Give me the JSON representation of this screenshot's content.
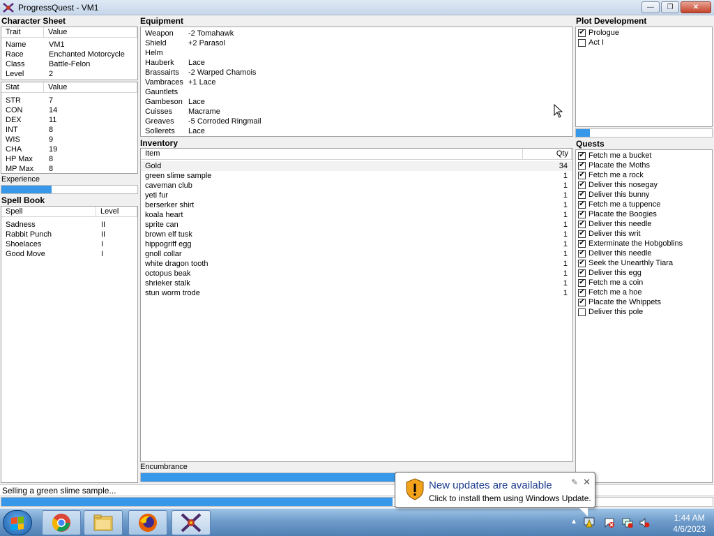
{
  "window": {
    "title": "ProgressQuest - VM1",
    "min": "—",
    "max": "❐",
    "close": "✕"
  },
  "character": {
    "section_title": "Character Sheet",
    "trait_header": "Trait",
    "value_header": "Value",
    "traits": [
      {
        "name": "Name",
        "value": "VM1"
      },
      {
        "name": "Race",
        "value": "Enchanted Motorcycle"
      },
      {
        "name": "Class",
        "value": "Battle-Felon"
      },
      {
        "name": "Level",
        "value": "2"
      }
    ],
    "stat_header": "Stat",
    "stat_value_header": "Value",
    "stats": [
      {
        "name": "STR",
        "value": "7"
      },
      {
        "name": "CON",
        "value": "14"
      },
      {
        "name": "DEX",
        "value": "11"
      },
      {
        "name": "INT",
        "value": "8"
      },
      {
        "name": "WIS",
        "value": "9"
      },
      {
        "name": "CHA",
        "value": "19"
      },
      {
        "name": "HP Max",
        "value": "8"
      },
      {
        "name": "MP Max",
        "value": "8"
      }
    ],
    "experience_label": "Experience",
    "experience_fraction": 0.37
  },
  "spellbook": {
    "section_title": "Spell Book",
    "spell_header": "Spell",
    "level_header": "Level",
    "spells": [
      {
        "name": "Sadness",
        "level": "II"
      },
      {
        "name": "Rabbit Punch",
        "level": "II"
      },
      {
        "name": "Shoelaces",
        "level": "I"
      },
      {
        "name": "Good Move",
        "level": "I"
      }
    ]
  },
  "equipment": {
    "section_title": "Equipment",
    "items": [
      {
        "slot": "Weapon",
        "item": "-2 Tomahawk"
      },
      {
        "slot": "Shield",
        "item": "+2 Parasol"
      },
      {
        "slot": "Helm",
        "item": ""
      },
      {
        "slot": "Hauberk",
        "item": "Lace"
      },
      {
        "slot": "Brassairts",
        "item": "-2 Warped Chamois"
      },
      {
        "slot": "Vambraces",
        "item": "+1 Lace"
      },
      {
        "slot": "Gauntlets",
        "item": ""
      },
      {
        "slot": "Gambeson",
        "item": "Lace"
      },
      {
        "slot": "Cuisses",
        "item": "Macrame"
      },
      {
        "slot": "Greaves",
        "item": "-5 Corroded Ringmail"
      },
      {
        "slot": "Sollerets",
        "item": "Lace"
      }
    ]
  },
  "inventory": {
    "section_title": "Inventory",
    "item_header": "Item",
    "qty_header": "Qty",
    "items": [
      {
        "name": "Gold",
        "qty": "34"
      },
      {
        "name": "green slime sample",
        "qty": "1"
      },
      {
        "name": "caveman club",
        "qty": "1"
      },
      {
        "name": "yeti fur",
        "qty": "1"
      },
      {
        "name": "berserker shirt",
        "qty": "1"
      },
      {
        "name": "koala heart",
        "qty": "1"
      },
      {
        "name": "sprite can",
        "qty": "1"
      },
      {
        "name": "brown elf tusk",
        "qty": "1"
      },
      {
        "name": "hippogriff egg",
        "qty": "1"
      },
      {
        "name": "gnoll collar",
        "qty": "1"
      },
      {
        "name": "white dragon tooth",
        "qty": "1"
      },
      {
        "name": "octopus beak",
        "qty": "1"
      },
      {
        "name": "shrieker stalk",
        "qty": "1"
      },
      {
        "name": "stun worm trode",
        "qty": "1"
      }
    ],
    "encumbrance_label": "Encumbrance",
    "encumbrance_fraction": 0.95
  },
  "plot": {
    "section_title": "Plot Development",
    "acts": [
      {
        "label": "Prologue",
        "checked": true
      },
      {
        "label": "Act I",
        "checked": false
      }
    ],
    "progress_fraction": 0.1
  },
  "quests": {
    "section_title": "Quests",
    "items": [
      {
        "label": "Fetch me a bucket",
        "checked": true
      },
      {
        "label": "Placate the Moths",
        "checked": true
      },
      {
        "label": "Fetch me a rock",
        "checked": true
      },
      {
        "label": "Deliver this nosegay",
        "checked": true
      },
      {
        "label": "Deliver this bunny",
        "checked": true
      },
      {
        "label": "Fetch me a tuppence",
        "checked": true
      },
      {
        "label": "Placate the Boogies",
        "checked": true
      },
      {
        "label": "Deliver this needle",
        "checked": true
      },
      {
        "label": "Deliver this writ",
        "checked": true
      },
      {
        "label": "Exterminate the Hobgoblins",
        "checked": true
      },
      {
        "label": "Deliver this needle",
        "checked": true
      },
      {
        "label": "Seek the Unearthly Tiara",
        "checked": true
      },
      {
        "label": "Deliver this egg",
        "checked": true
      },
      {
        "label": "Fetch me a coin",
        "checked": true
      },
      {
        "label": "Fetch me a hoe",
        "checked": true
      },
      {
        "label": "Placate the Whippets",
        "checked": true
      },
      {
        "label": "Deliver this pole",
        "checked": false
      }
    ]
  },
  "status": {
    "text": "Selling a green slime sample...",
    "task_fraction": 0.55
  },
  "notification": {
    "title": "New updates are available",
    "text": "Click to install them using Windows Update.",
    "close": "✕",
    "options": "✎"
  },
  "taskbar": {
    "time": "1:44 AM",
    "date": "4/6/2023"
  },
  "colors": {
    "progress": "#3797e8",
    "title_text": "#1c3c8c"
  }
}
